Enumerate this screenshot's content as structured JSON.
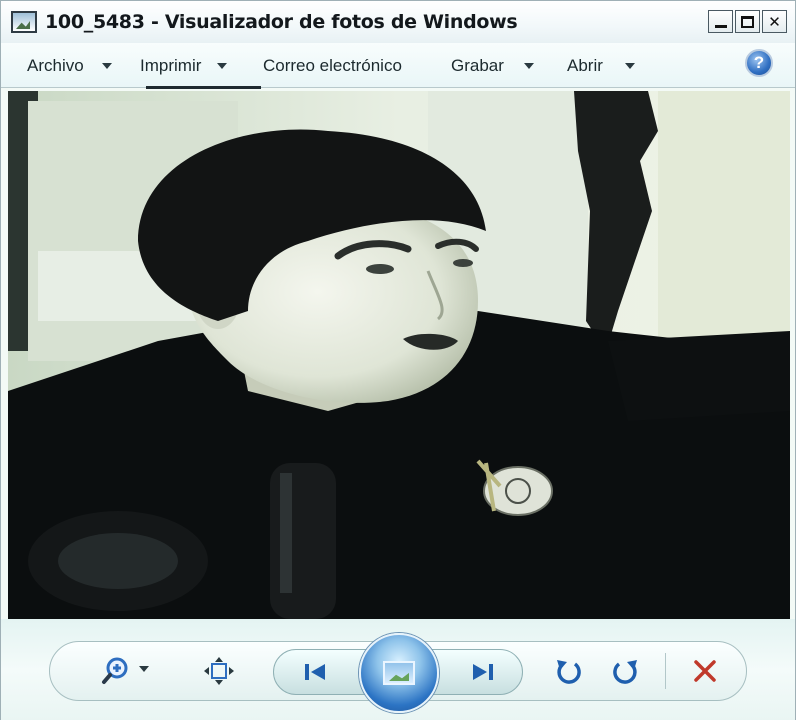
{
  "window": {
    "title": "100_5483 - Visualizador de fotos de Windows",
    "controls": {
      "minimize": "_",
      "maximize": "□",
      "close": "✕"
    }
  },
  "menu": {
    "items": [
      {
        "label": "Archivo",
        "has_caret": true
      },
      {
        "label": "Imprimir",
        "has_caret": true
      },
      {
        "label": "Correo electrónico",
        "has_caret": false
      },
      {
        "label": "Grabar",
        "has_caret": true
      },
      {
        "label": "Abrir",
        "has_caret": true
      }
    ],
    "help_icon": "help-icon",
    "help_glyph": "?"
  },
  "photo": {
    "description_icon": "photo-content"
  },
  "toolbar": {
    "buttons": [
      {
        "name": "zoom-icon"
      },
      {
        "name": "actual-size-icon"
      },
      {
        "name": "previous-icon"
      },
      {
        "name": "slideshow-icon"
      },
      {
        "name": "next-icon"
      },
      {
        "name": "rotate-counterclockwise-icon"
      },
      {
        "name": "rotate-clockwise-icon"
      },
      {
        "name": "delete-icon"
      }
    ],
    "colors": {
      "accent": "#2c74c4",
      "delete": "#c0392b"
    }
  }
}
